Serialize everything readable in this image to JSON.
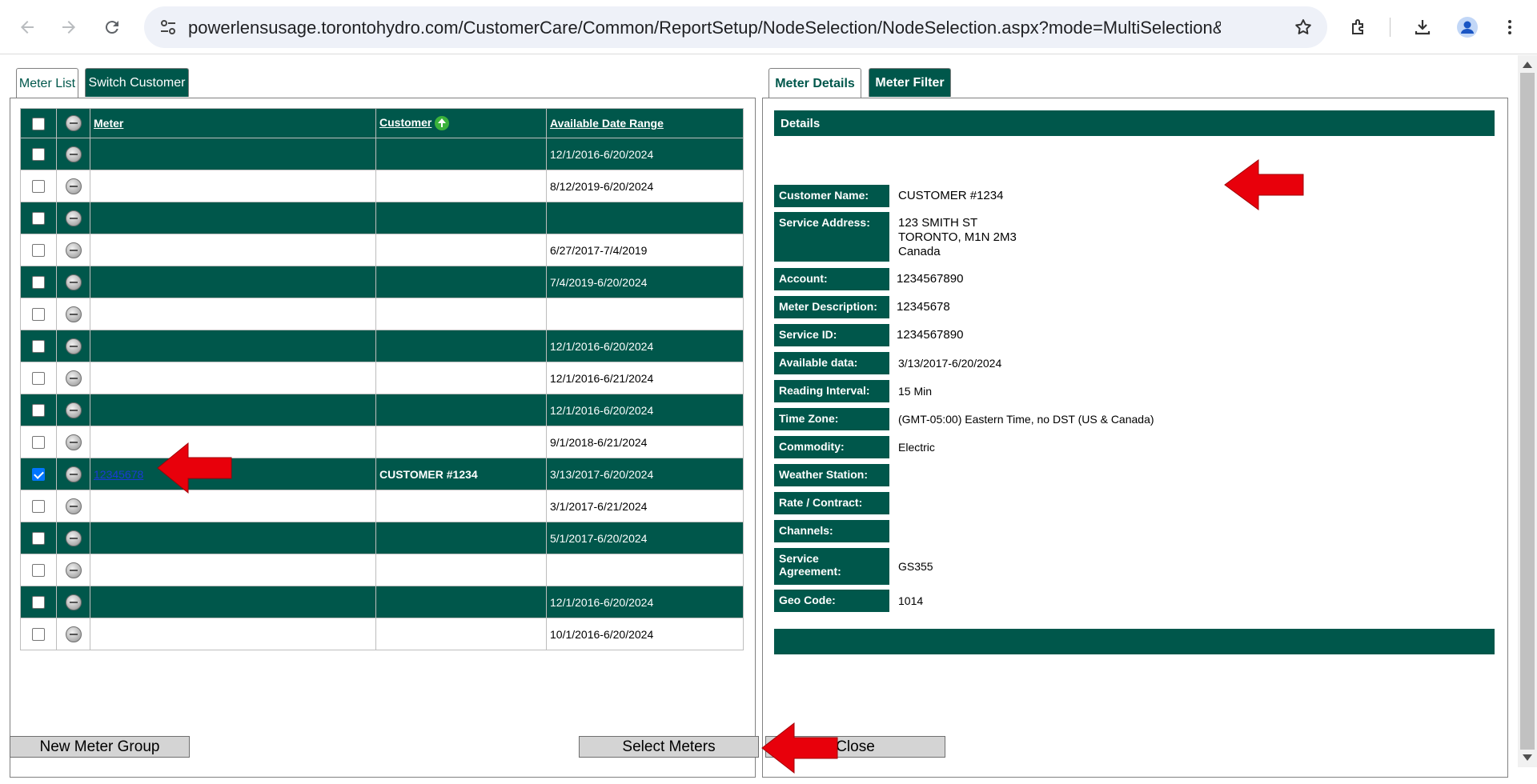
{
  "browser": {
    "url": "powerlensusage.torontohydro.com/CustomerCare/Common/ReportSetup/NodeSelection/NodeSelection.aspx?mode=MultiSelection&disablegro..."
  },
  "left_tabs": [
    {
      "label": "Meter List",
      "active": true
    },
    {
      "label": "Switch Customer",
      "active": false
    }
  ],
  "right_tabs": [
    {
      "label": "Meter Details",
      "active": true
    },
    {
      "label": "Meter Filter",
      "active": false
    }
  ],
  "meter_table": {
    "columns": [
      "Meter",
      "Customer",
      "Available Date Range"
    ],
    "rows": [
      {
        "checked": false,
        "meter": "",
        "customer": "",
        "range": "12/1/2016-6/20/2024"
      },
      {
        "checked": false,
        "meter": "",
        "customer": "",
        "range": "8/12/2019-6/20/2024"
      },
      {
        "checked": false,
        "meter": "",
        "customer": "",
        "range": ""
      },
      {
        "checked": false,
        "meter": "",
        "customer": "",
        "range": "6/27/2017-7/4/2019"
      },
      {
        "checked": false,
        "meter": "",
        "customer": "",
        "range": "7/4/2019-6/20/2024"
      },
      {
        "checked": false,
        "meter": "",
        "customer": "",
        "range": ""
      },
      {
        "checked": false,
        "meter": "",
        "customer": "",
        "range": "12/1/2016-6/20/2024"
      },
      {
        "checked": false,
        "meter": "",
        "customer": "",
        "range": "12/1/2016-6/21/2024"
      },
      {
        "checked": false,
        "meter": "",
        "customer": "",
        "range": "12/1/2016-6/20/2024"
      },
      {
        "checked": false,
        "meter": "",
        "customer": "",
        "range": "9/1/2018-6/21/2024"
      },
      {
        "checked": true,
        "meter": "12345678",
        "customer": "CUSTOMER #1234",
        "range": "3/13/2017-6/20/2024"
      },
      {
        "checked": false,
        "meter": "",
        "customer": "",
        "range": "3/1/2017-6/21/2024"
      },
      {
        "checked": false,
        "meter": "",
        "customer": "",
        "range": "5/1/2017-6/20/2024"
      },
      {
        "checked": false,
        "meter": "",
        "customer": "",
        "range": ""
      },
      {
        "checked": false,
        "meter": "",
        "customer": "",
        "range": "12/1/2016-6/20/2024"
      },
      {
        "checked": false,
        "meter": "",
        "customer": "",
        "range": "10/1/2016-6/20/2024"
      }
    ]
  },
  "details": {
    "header": "Details",
    "customer_name": {
      "label": "Customer Name:",
      "value": "CUSTOMER #1234"
    },
    "service_address": {
      "label": "Service Address:",
      "value": "123 SMITH ST\nTORONTO, M1N 2M3\nCanada"
    },
    "account": {
      "label": "Account:",
      "value": "1234567890"
    },
    "meter_description": {
      "label": "Meter Description:",
      "value": "12345678"
    },
    "service_id": {
      "label": "Service ID:",
      "value": "1234567890"
    },
    "available_data": {
      "label": "Available data:",
      "value": "3/13/2017-6/20/2024"
    },
    "reading_interval": {
      "label": "Reading Interval:",
      "value": "15 Min"
    },
    "time_zone": {
      "label": "Time Zone:",
      "value": "(GMT-05:00) Eastern Time, no DST (US & Canada)"
    },
    "commodity": {
      "label": "Commodity:",
      "value": "Electric"
    },
    "weather_station": {
      "label": "Weather Station:",
      "value": ""
    },
    "rate_contract": {
      "label": "Rate / Contract:",
      "value": ""
    },
    "channels": {
      "label": "Channels:",
      "value": ""
    },
    "service_agreement": {
      "label": "Service\nAgreement:",
      "value": "GS355"
    },
    "geo_code": {
      "label": "Geo Code:",
      "value": "1014"
    }
  },
  "buttons": {
    "new_meter_group": "New Meter Group",
    "select_meters": "Select Meters",
    "close": "Close"
  },
  "colors": {
    "brand_green": "#00574b",
    "annotation_red": "#e8000b"
  }
}
